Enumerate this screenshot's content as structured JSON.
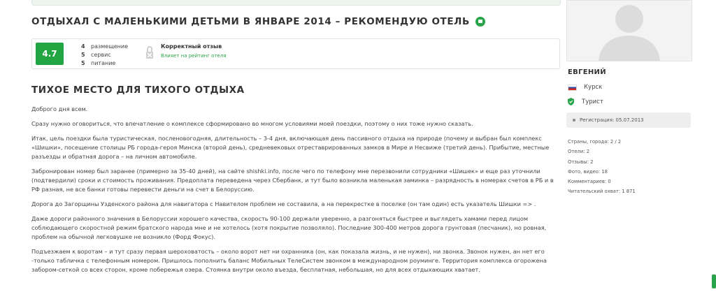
{
  "review": {
    "title": "ОТДЫХАЛ С МАЛЕНЬКИМИ ДЕТЬМИ В ЯНВАРЕ 2014 – РЕКОМЕНДУЮ ОТЕЛЬ",
    "score": "4.7",
    "subratings": [
      {
        "value": "4",
        "label": "размещение"
      },
      {
        "value": "5",
        "label": "сервис"
      },
      {
        "value": "5",
        "label": "питание"
      }
    ],
    "verify_title": "Корректный отзыв",
    "verify_sub": "Влияет на рейтинг отеля",
    "subtitle": "ТИХОЕ МЕСТО ДЛЯ ТИХОГО ОТДЫХА",
    "paragraphs": [
      "Доброго дня всем.",
      "Сразу нужно оговориться, что впечатление о комплексе сформировано во многом условиями моей поездки, поэтому о них тоже нужно сказать.",
      "Итак, цель поездки была туристическая, посленовогодняя, длительность – 3-4 дня, включающая день пассивного отдыха на природе (почему и выбран был комплекс «Шишки», посещение столицы РБ города-героя Минска (второй день), средневековых отреставрированных замков в Мире и Несвиже (третий день). Прибытие, местные разъезды и обратная дорога – на личном автомобиле.",
      "Забронирован номер был заранее (примерно за 35-40 дней), на сайте shishki.info, после чего по телефону мне перезвонили сотрудники «Шишек» и еще раз уточнили (подтвердили) сроки и стоимость проживания. Предоплата переведена через Сбербанк, и тут было возникла маленькая заминка – разрядность в номерах счетов в РБ и в РФ разная, не все банки готовы перевести деньги на счет в Белоруссию.",
      "Дорога до Загорщины Узденского района для навигатора с Навителом проблем не составила, а на перекрестке в поселке (он там один) есть указатель Шишки => .",
      "Даже дороги районного значения в Белоруссии хорошего качества, скорость 90-100 держали уверенно, а разгоняться быстрее и выглядеть хамами перед лицом соблюдающего скоростной режим братского народа мне и не хотелось (хотя покрытие позволяло). Последние 300-400 метров дорога грунтовая (песчаник), но ровная, проблем на обычной легковушке не возникло (Форд Фокус).",
      "Подъезжаем к воротам – и тут сразу первая шероховатость – около ворот нет ни охранника (он, как показала жизнь, и не нужен), ни звонка. Звонок нужен, ан нет его -только табличка с телефонным номером. Пришлось пополнить баланс Мобильных ТелеСистем звонком в международном роуминге. Территория комплекса огорожена забором-сеткой со всех сторон, кроме побережья озера. Стоянка внутри около въезда, бесплатная, небольшая, но для всех отдыхающих хватает."
    ]
  },
  "profile": {
    "name": "ЕВГЕНИЙ",
    "city": "Курск",
    "status": "Турист",
    "registration": "Регистрация: 05.07.2013",
    "stats": [
      "Страны, города: 2 / 2",
      "Отели: 2",
      "Отзывы: 2",
      "Фото, видео: 18",
      "Комментариев: 0",
      "Читательский охват: 1 871"
    ]
  },
  "colors": {
    "accent": "#22a543",
    "text": "#333333"
  }
}
